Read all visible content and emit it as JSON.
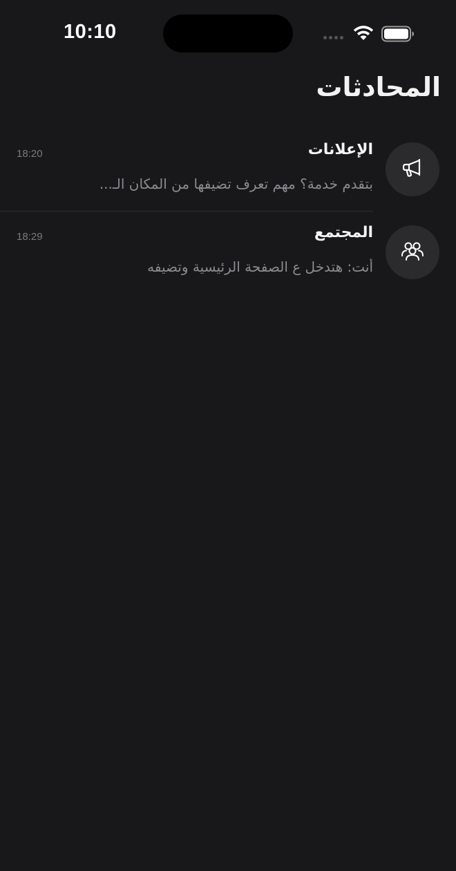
{
  "status_bar": {
    "time": "10:10"
  },
  "header": {
    "title": "المحادثات"
  },
  "conversations": [
    {
      "name": "الإعلانات",
      "preview": "بتقدم خدمة؟ مهم تعرف تضيفها من المكان الـ...",
      "time": "18:20",
      "icon": "megaphone-icon"
    },
    {
      "name": "المجتمع",
      "preview": "أنت: هتدخل ع الصفحة الرئيسية وتضيفه",
      "time": "18:29",
      "icon": "people-group-icon"
    }
  ],
  "colors": {
    "background": "#18181a",
    "avatar_bg": "#2b2b2e",
    "preview_text": "#8c8c90",
    "time_text": "#7a7a7e"
  }
}
